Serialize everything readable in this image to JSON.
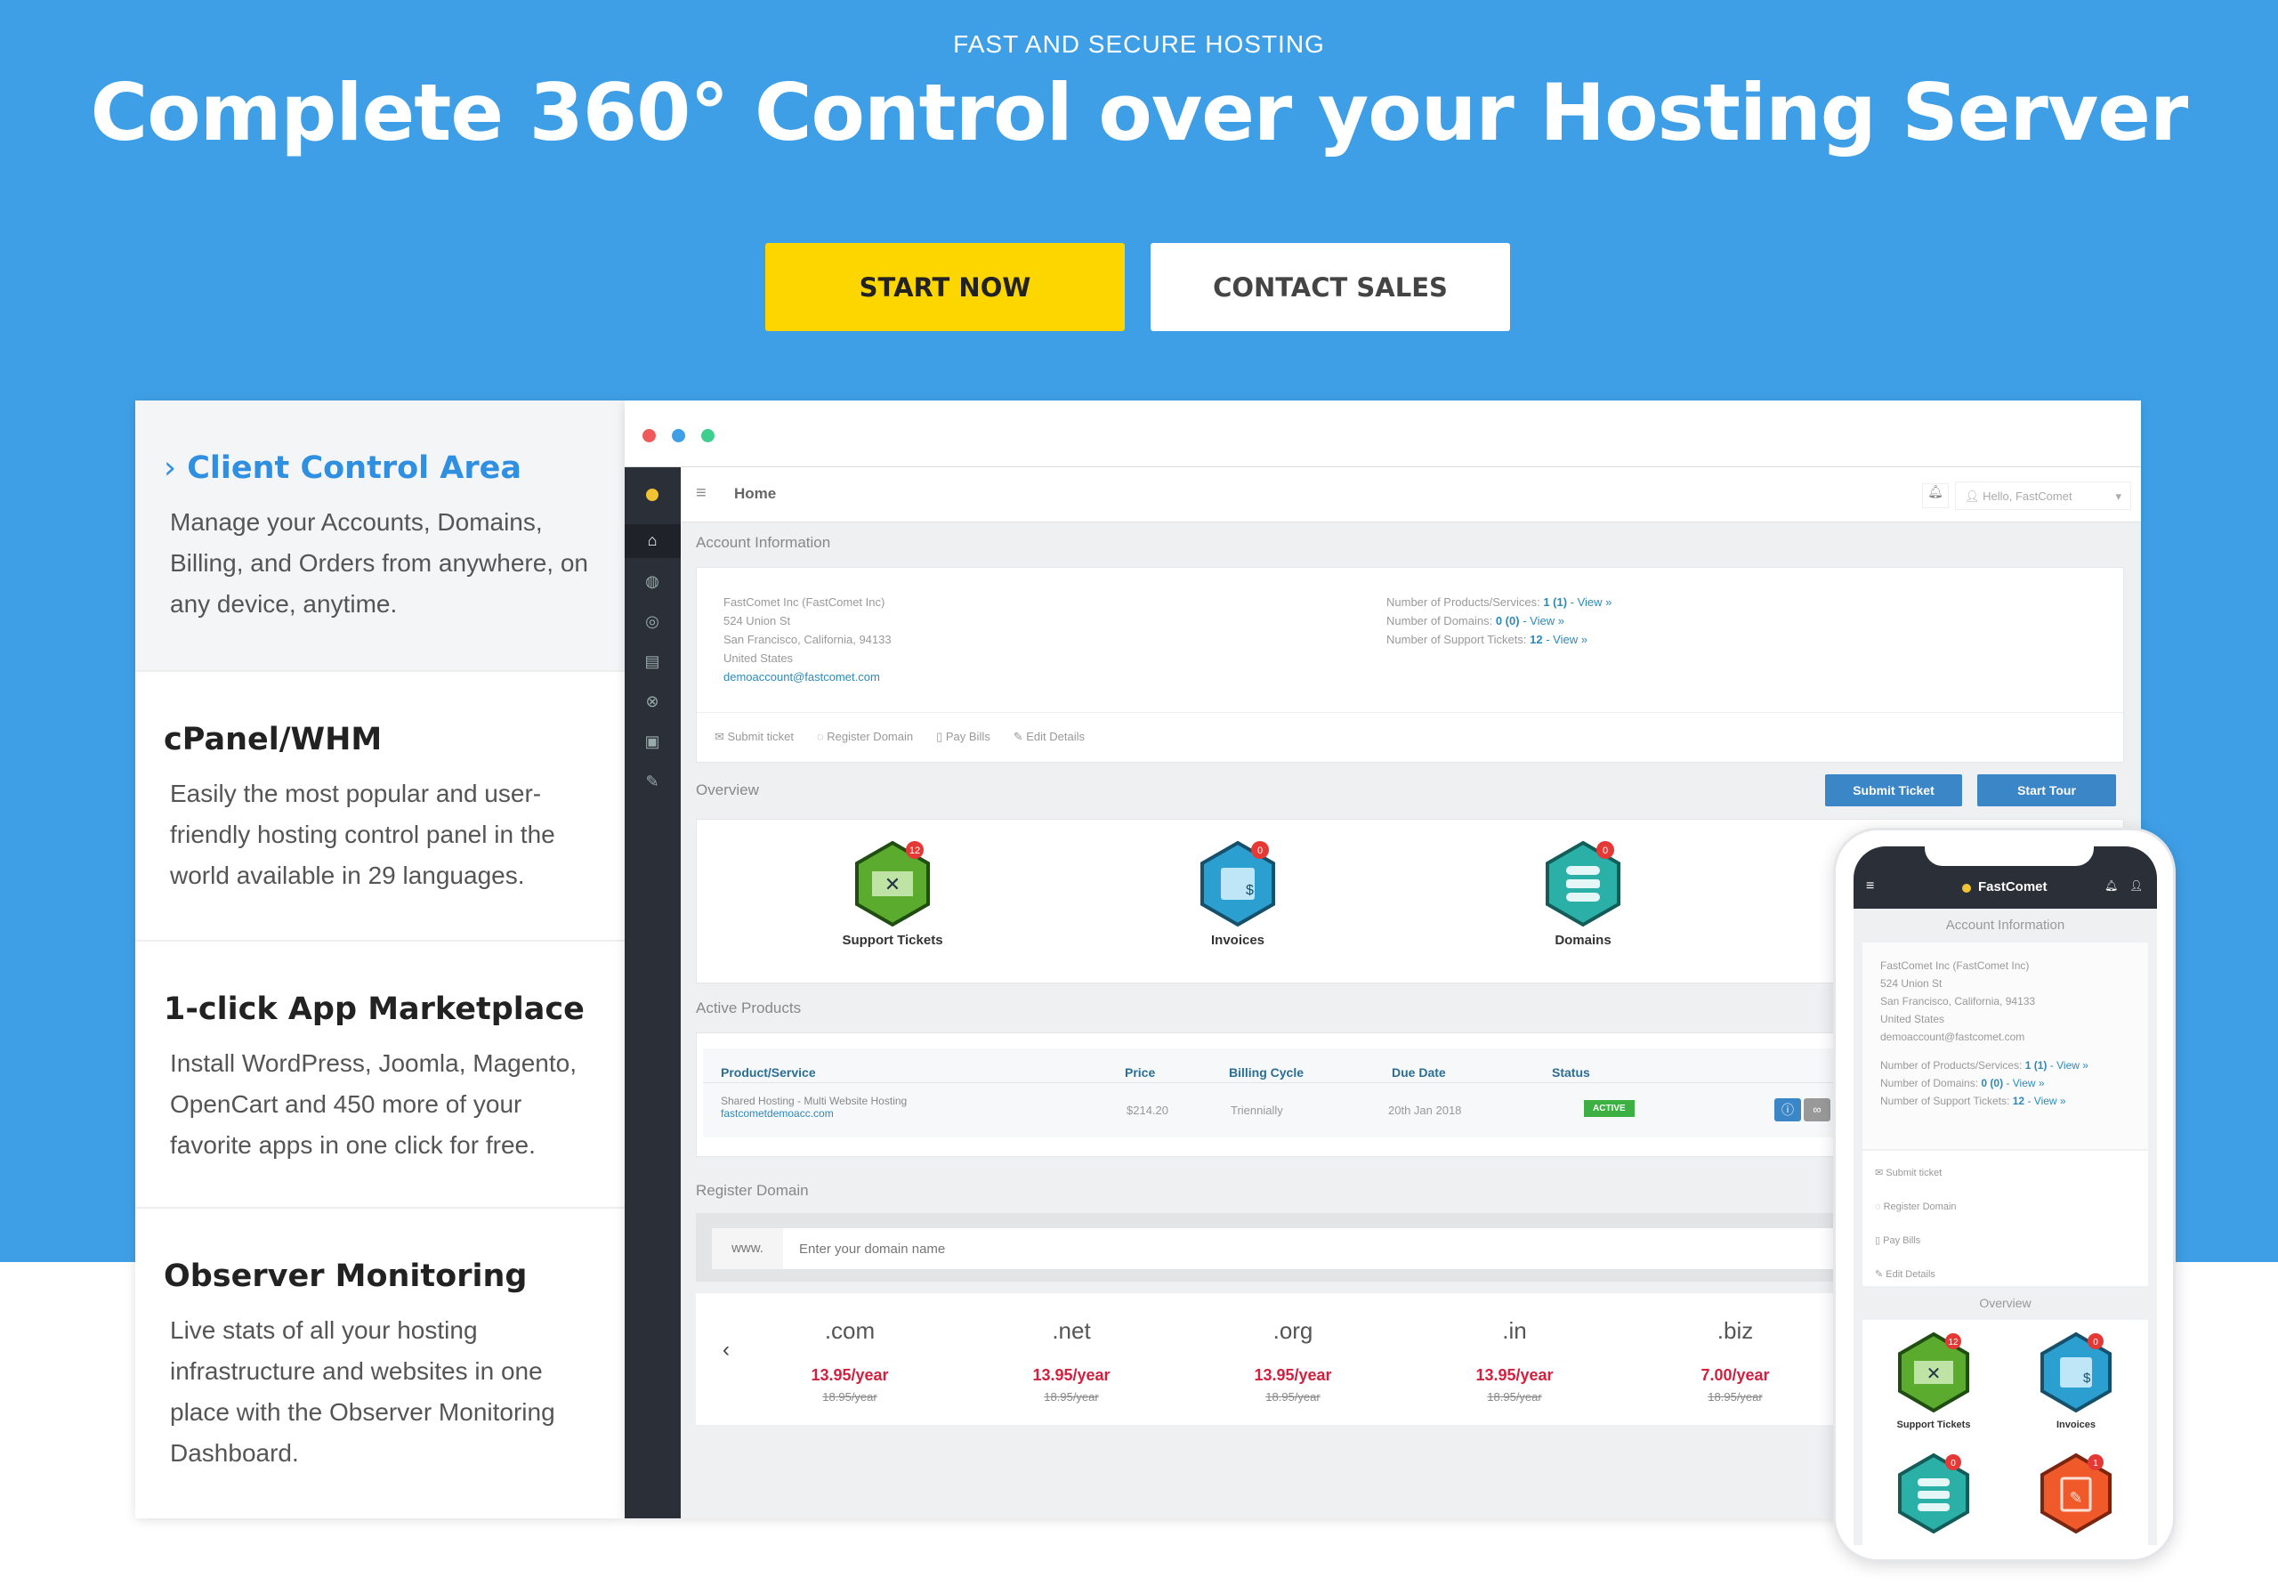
{
  "hero": {
    "kicker": "FAST AND SECURE HOSTING",
    "title": "Complete 360° Control over your Hosting Server",
    "start_label": "START NOW",
    "contact_label": "CONTACT SALES",
    "bg": "#3f9fe6",
    "accent": "#fdd600"
  },
  "features": [
    {
      "title": "Client Control Area",
      "desc": "Manage your Accounts, Domains, Billing, and Orders from anywhere, on any device, anytime."
    },
    {
      "title": "cPanel/WHM",
      "desc": "Easily the most popular and user-friendly hosting control panel in the world available in 29 languages."
    },
    {
      "title": "1-click App Marketplace",
      "desc": "Install WordPress, Joomla, Magento, OpenCart and 450 more of your favorite apps in one click for free."
    },
    {
      "title": "Observer Monitoring",
      "desc": "Live stats of all your hosting infrastructure and websites in one place with the Observer Monitoring Dashboard."
    }
  ],
  "dashboard": {
    "home": "Home",
    "greeting": "Hello, FastComet",
    "account_title": "Account Information",
    "address": [
      "FastComet Inc (FastComet Inc)",
      "524 Union St",
      "San Francisco, California, 94133",
      "United States"
    ],
    "email": "demoaccount@fastcomet.com",
    "stats": [
      {
        "label": "Number of Products/Services:",
        "value": "1 (1)",
        "link": "- View »"
      },
      {
        "label": "Number of Domains:",
        "value": "0 (0)",
        "link": "- View »"
      },
      {
        "label": "Number of Support Tickets:",
        "value": "12",
        "link": "- View »"
      }
    ],
    "actions": [
      "Submit ticket",
      "Register Domain",
      "Pay Bills",
      "Edit Details"
    ],
    "overview_title": "Overview",
    "submit_ticket": "Submit Ticket",
    "start_tour": "Start Tour",
    "tiles": [
      {
        "label": "Support Tickets",
        "badge": "12",
        "color": "#5aab2e"
      },
      {
        "label": "Invoices",
        "badge": "0",
        "color": "#2a9fd0"
      },
      {
        "label": "Domains",
        "badge": "0",
        "color": "#2bb0a8"
      }
    ],
    "active_title": "Active Products",
    "table": {
      "headers": [
        "Product/Service",
        "Price",
        "Billing Cycle",
        "Due Date",
        "Status"
      ],
      "rows": [
        {
          "product": "Shared Hosting - Multi Website Hosting",
          "domain": "fastcometdemoacc.com",
          "price": "$214.20",
          "cycle": "Triennially",
          "due": "20th Jan 2018",
          "status": "ACTIVE"
        }
      ]
    },
    "register_title": "Register Domain",
    "www": "www.",
    "domain_placeholder": "Enter your domain name",
    "tlds": [
      {
        "tld": ".com",
        "price": "13.95/year",
        "old": "18.95/year"
      },
      {
        "tld": ".net",
        "price": "13.95/year",
        "old": "18.95/year"
      },
      {
        "tld": ".org",
        "price": "13.95/year",
        "old": "18.95/year"
      },
      {
        "tld": ".in",
        "price": "13.95/year",
        "old": "18.95/year"
      },
      {
        "tld": ".biz",
        "price": "7.00/year",
        "old": "18.95/year"
      }
    ]
  },
  "phone": {
    "brand": "FastComet",
    "account_title": "Account Information",
    "overview_title": "Overview",
    "tiles": [
      {
        "label": "Support Tickets",
        "badge": "12"
      },
      {
        "label": "Invoices",
        "badge": "0"
      },
      {
        "badge": "0"
      },
      {
        "badge": "1"
      }
    ]
  }
}
